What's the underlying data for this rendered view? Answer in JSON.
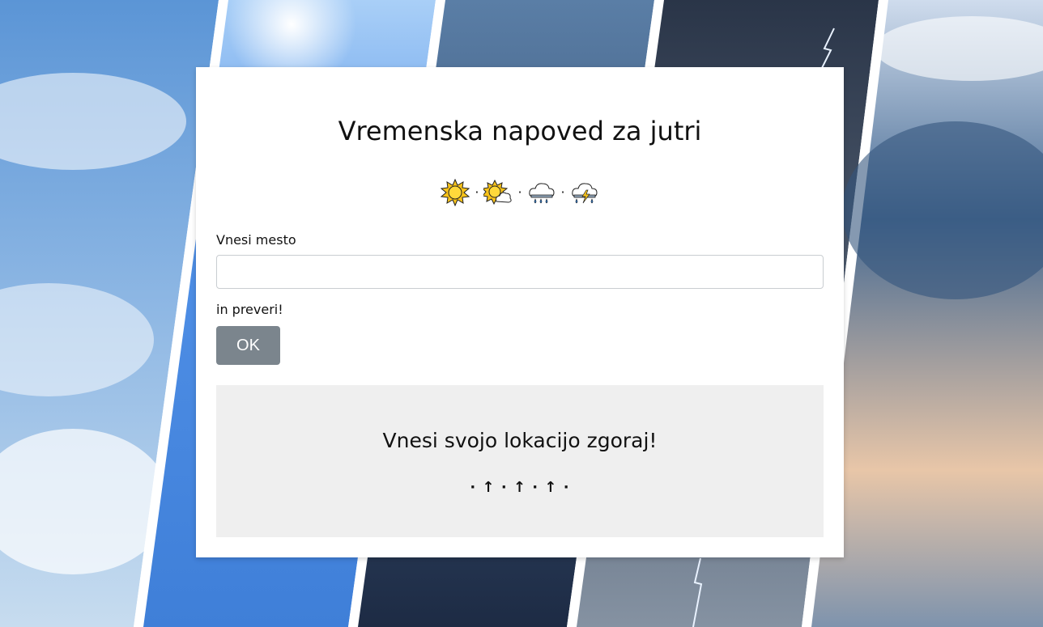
{
  "page": {
    "title": "Vremenska napoved za jutri"
  },
  "icons": [
    {
      "name": "sun-icon"
    },
    {
      "name": "sun-behind-cloud-icon"
    },
    {
      "name": "rain-cloud-icon"
    },
    {
      "name": "thunderstorm-icon"
    }
  ],
  "icon_separator": "·",
  "form": {
    "city_label": "Vnesi mesto",
    "city_value": "",
    "city_placeholder": "",
    "check_label": "in preveri!",
    "ok_label": "OK"
  },
  "result": {
    "message": "Vnesi svojo lokacijo zgoraj!",
    "arrows": "· ↑ · ↑ · ↑ ·"
  },
  "colors": {
    "card_background": "#ffffff",
    "button_background": "#7b858d",
    "button_text": "#ffffff",
    "result_background": "#efefef"
  }
}
